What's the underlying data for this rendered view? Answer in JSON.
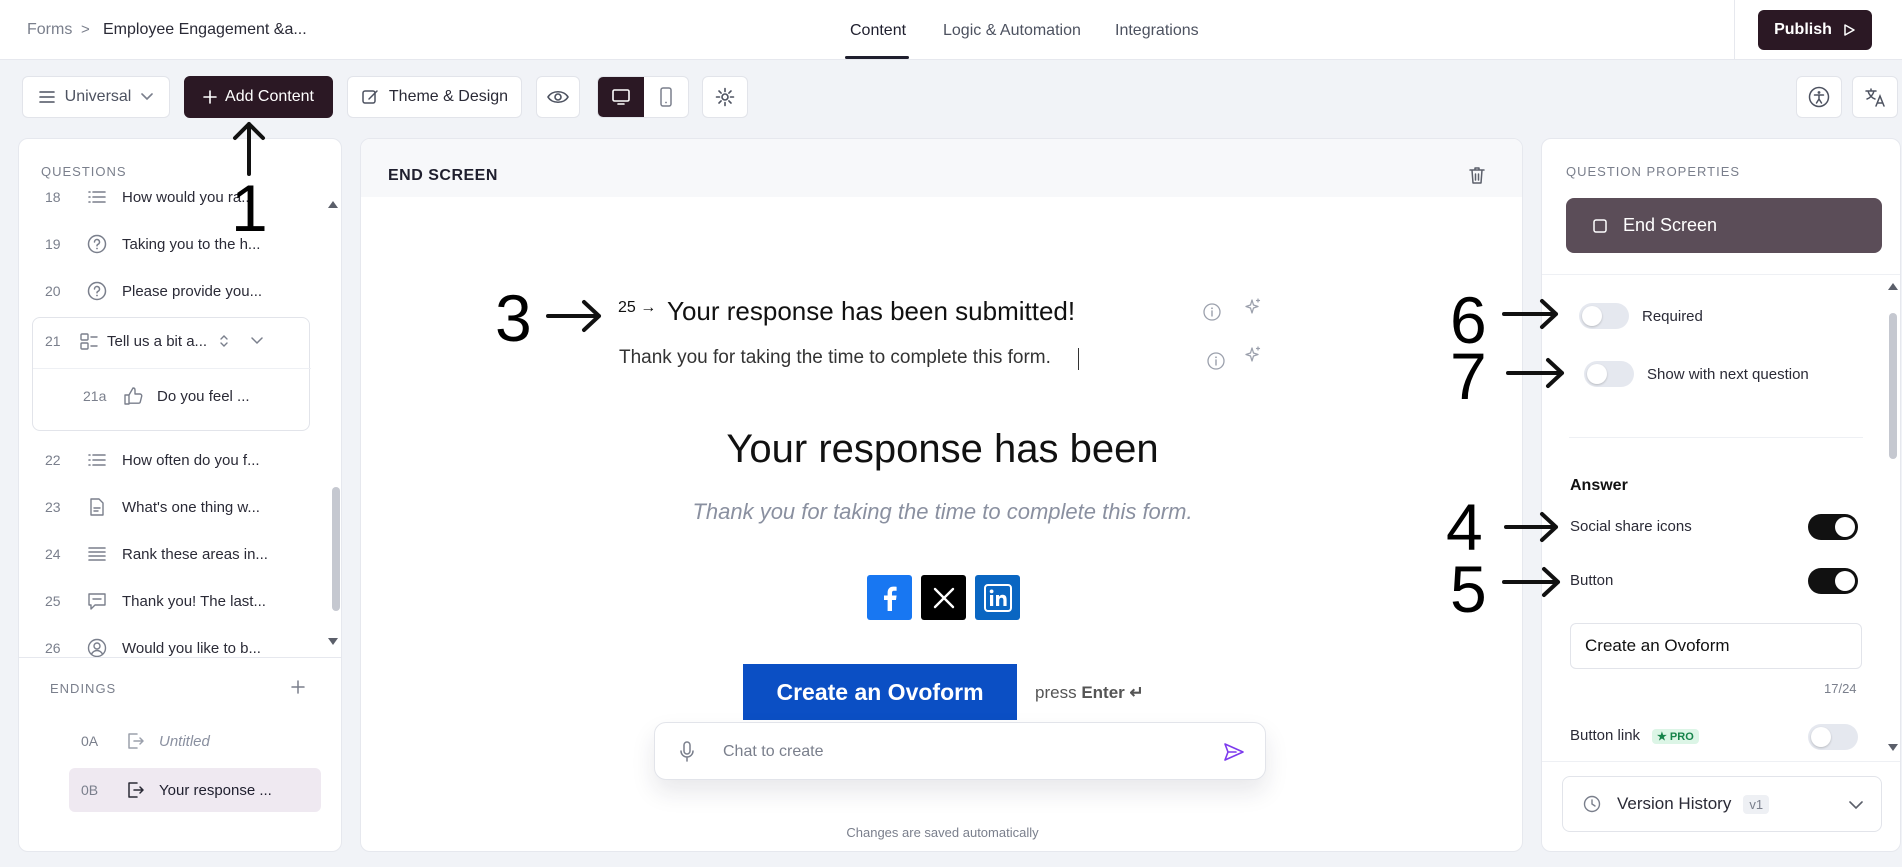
{
  "breadcrumb": {
    "root": "Forms",
    "separator": ">",
    "current": "Employee Engagement &a..."
  },
  "nav_tabs": [
    {
      "label": "Content",
      "active": true
    },
    {
      "label": "Logic & Automation",
      "active": false
    },
    {
      "label": "Integrations",
      "active": false
    }
  ],
  "publish_label": "Publish",
  "toolbar": {
    "universal_label": "Universal",
    "add_content_label": "Add Content",
    "theme_label": "Theme & Design"
  },
  "questions_label": "QUESTIONS",
  "questions": [
    {
      "num": "18",
      "icon": "list-icon",
      "text": "How would you ra..."
    },
    {
      "num": "19",
      "icon": "question-circle-icon",
      "text": "Taking you to the h..."
    },
    {
      "num": "20",
      "icon": "question-circle-icon",
      "text": "Please provide you..."
    },
    {
      "num": "21",
      "icon": "multi-field-icon",
      "text": "Tell us a bit a..."
    },
    {
      "num": "21a",
      "icon": "thumbs-up-icon",
      "text": "Do you feel ..."
    },
    {
      "num": "22",
      "icon": "list-icon",
      "text": "How often do you f..."
    },
    {
      "num": "23",
      "icon": "document-icon",
      "text": "What's one thing w..."
    },
    {
      "num": "24",
      "icon": "rank-icon",
      "text": "Rank these areas in..."
    },
    {
      "num": "25",
      "icon": "chat-bubble-icon",
      "text": "Thank you! The last..."
    },
    {
      "num": "26",
      "icon": "user-circle-icon",
      "text": "Would you like to b..."
    }
  ],
  "endings_label": "ENDINGS",
  "endings": [
    {
      "code": "0A",
      "text": "Untitled"
    },
    {
      "code": "0B",
      "text": "Your response ..."
    }
  ],
  "center": {
    "header_title": "END SCREEN",
    "question_number": "25 →",
    "edit_title": "Your response has been submitted!",
    "edit_subtitle": "Thank you for taking the time to complete this form.",
    "preview_title": "Your response has been",
    "preview_subtitle": "Thank you for taking the time to complete this form.",
    "cta_label": "Create an Ovoform",
    "press_label": "press",
    "enter_label": "Enter ↵",
    "chat_placeholder": "Chat to create",
    "saved_note": "Changes are saved automatically"
  },
  "properties": {
    "section_label": "QUESTION PROPERTIES",
    "type_label": "End Screen",
    "required_label": "Required",
    "required_on": false,
    "show_next_label": "Show with next question",
    "show_next_on": false,
    "answer_label": "Answer",
    "social_label": "Social share icons",
    "social_on": true,
    "button_label": "Button",
    "button_on": true,
    "button_text": "Create an Ovoform",
    "char_count": "17/24",
    "button_link_label": "Button link",
    "pro_badge": "★ PRO",
    "button_link_on": false,
    "version_history_label": "Version History",
    "version_badge": "v1"
  },
  "annotations": [
    "1",
    "3",
    "4",
    "5",
    "6",
    "7"
  ],
  "colors": {
    "primary_dark": "#2b1824",
    "cta_blue": "#0b4fc4",
    "facebook": "#1877f2",
    "linkedin": "#0a66c2",
    "x": "#000000"
  }
}
